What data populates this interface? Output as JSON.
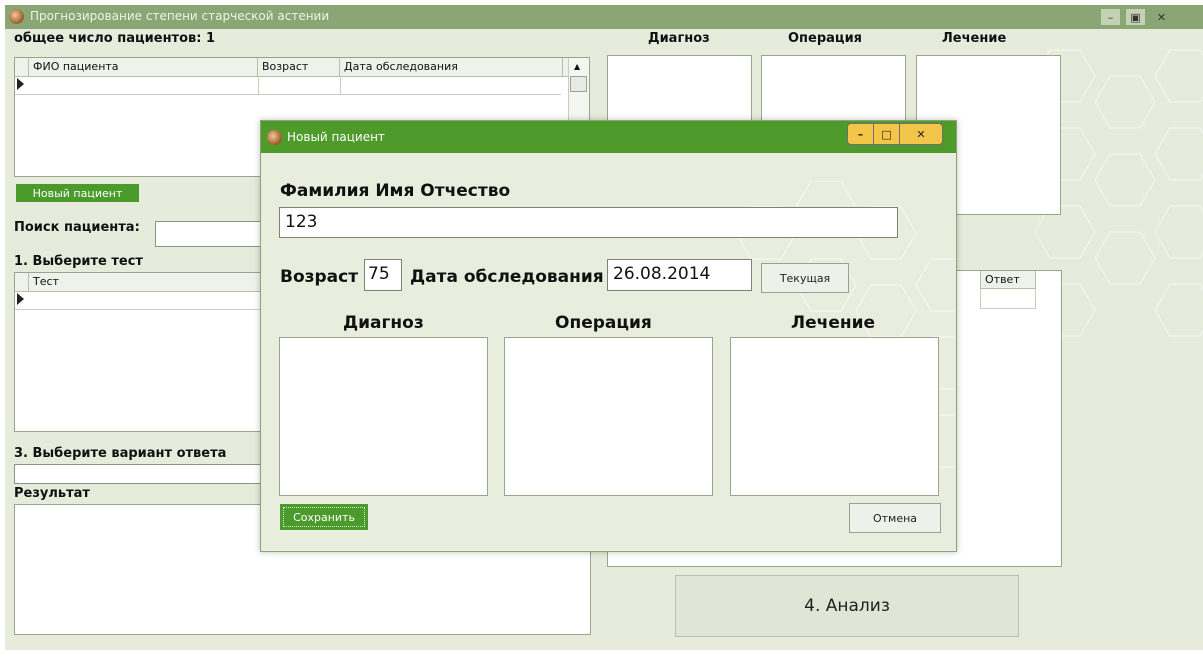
{
  "main": {
    "title": "Прогнозирование степени старческой астении",
    "patient_count": "общее число пациентов: 1",
    "patients_table": {
      "columns": [
        "ФИО пациента",
        "Возраст",
        "Дата обследования"
      ]
    },
    "new_patient_button": "Новый пациент",
    "search_label": "Поиск пациента:",
    "select_test_label": "1. Выберите тест",
    "test_table": {
      "columns": [
        "Тест"
      ]
    },
    "answer_column": "Ответ",
    "select_answer_label": "3. Выберите вариант ответа",
    "result_label": "Результат",
    "diagnosis_header": "Диагноз",
    "operation_header": "Операция",
    "treatment_header": "Лечение",
    "analyze_button": "4. Анализ"
  },
  "dialog": {
    "title": "Новый пациент",
    "fio_label": "Фамилия Имя Отчество",
    "fio_value": "123",
    "age_label": "Возраст",
    "age_value": "75",
    "date_label": "Дата обследования",
    "date_value": "26.08.2014",
    "current_button": "Текущая",
    "diagnosis_label": "Диагноз",
    "operation_label": "Операция",
    "treatment_label": "Лечение",
    "save_button": "Сохранить",
    "cancel_button": "Отмена"
  },
  "icons": {
    "minimize": "minimize-icon",
    "maximize": "maximize-icon",
    "restore": "restore-icon",
    "close": "close-icon"
  },
  "colors": {
    "titlebar": "#8aa675",
    "dialog_titlebar": "#4e9a2a",
    "accent_button": "#4a9a2c",
    "window_bg": "#e6ebdc"
  }
}
